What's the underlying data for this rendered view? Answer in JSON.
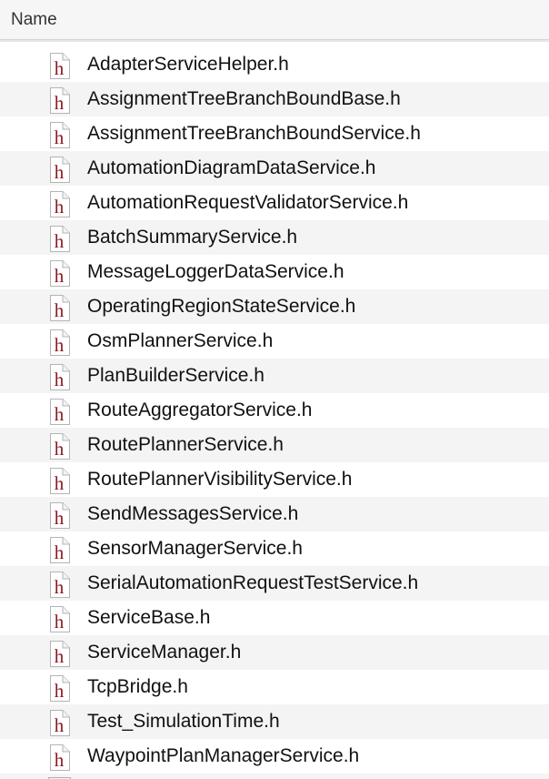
{
  "header": {
    "name_label": "Name"
  },
  "icons": {
    "header_file": "header-file-icon",
    "glyph": "h",
    "glyph_color": "#8b1a22"
  },
  "files": [
    {
      "name": "AdapterServiceHelper.h"
    },
    {
      "name": "AssignmentTreeBranchBoundBase.h"
    },
    {
      "name": "AssignmentTreeBranchBoundService.h"
    },
    {
      "name": "AutomationDiagramDataService.h"
    },
    {
      "name": "AutomationRequestValidatorService.h"
    },
    {
      "name": "BatchSummaryService.h"
    },
    {
      "name": "MessageLoggerDataService.h"
    },
    {
      "name": "OperatingRegionStateService.h"
    },
    {
      "name": "OsmPlannerService.h"
    },
    {
      "name": "PlanBuilderService.h"
    },
    {
      "name": "RouteAggregatorService.h"
    },
    {
      "name": "RoutePlannerService.h"
    },
    {
      "name": "RoutePlannerVisibilityService.h"
    },
    {
      "name": "SendMessagesService.h"
    },
    {
      "name": "SensorManagerService.h"
    },
    {
      "name": "SerialAutomationRequestTestService.h"
    },
    {
      "name": "ServiceBase.h"
    },
    {
      "name": "ServiceManager.h"
    },
    {
      "name": "TcpBridge.h"
    },
    {
      "name": "Test_SimulationTime.h"
    },
    {
      "name": "WaypointPlanManagerService.h"
    }
  ]
}
